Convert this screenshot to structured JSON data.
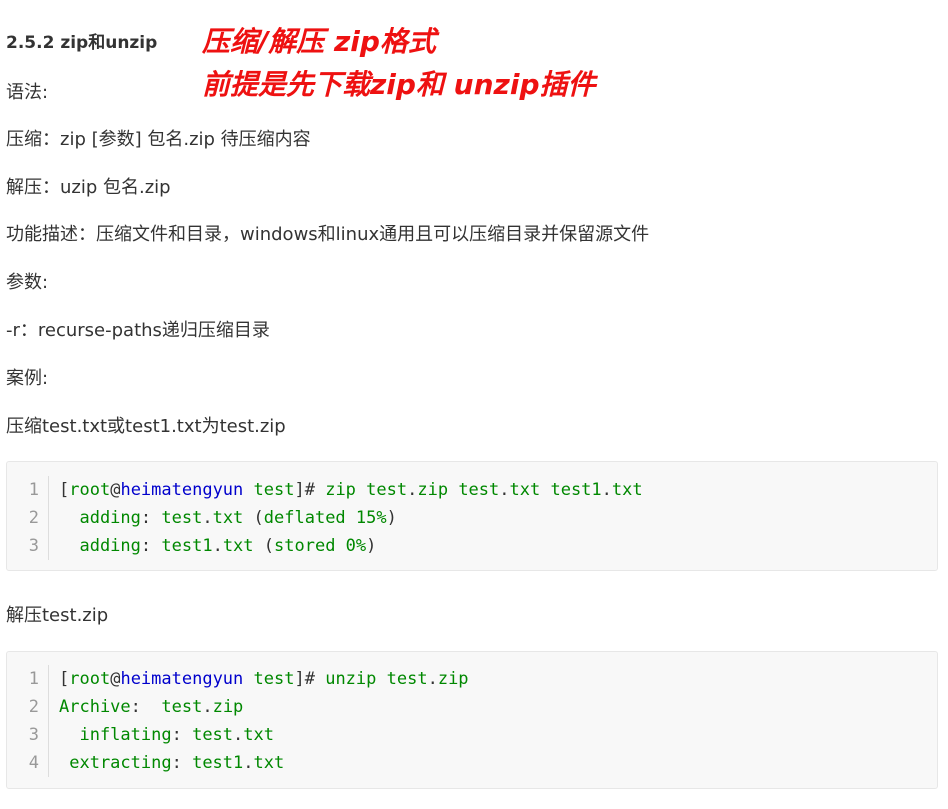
{
  "heading": "2.5.2 zip和unzip",
  "annotations": {
    "line1": "压缩/解压    zip格式",
    "line2": "前提是先下载zip和 unzip插件"
  },
  "paragraphs": {
    "syntax": "语法:",
    "compress": " 压缩：zip [参数] 包名.zip 待压缩内容",
    "decompress": " 解压：uzip 包名.zip",
    "description": "功能描述：压缩文件和目录，windows和linux通用且可以压缩目录并保留源文件",
    "params": "参数:",
    "param_r": " -r：recurse-paths递归压缩目录",
    "example": "案例:",
    "example1": "压缩test.txt或test1.txt为test.zip",
    "example2": "解压test.zip"
  },
  "code1": {
    "line_numbers": [
      "1",
      "2",
      "3"
    ],
    "lines": [
      [
        {
          "t": "[",
          "c": "d"
        },
        {
          "t": "root",
          "c": "g"
        },
        {
          "t": "@",
          "c": "d"
        },
        {
          "t": "heimatengyun",
          "c": "b"
        },
        {
          "t": " ",
          "c": "d"
        },
        {
          "t": "test",
          "c": "g"
        },
        {
          "t": "]# ",
          "c": "d"
        },
        {
          "t": "zip ",
          "c": "g"
        },
        {
          "t": "test",
          "c": "g"
        },
        {
          "t": ".",
          "c": "d"
        },
        {
          "t": "zip ",
          "c": "g"
        },
        {
          "t": "test",
          "c": "g"
        },
        {
          "t": ".",
          "c": "d"
        },
        {
          "t": "txt ",
          "c": "g"
        },
        {
          "t": "test1",
          "c": "g"
        },
        {
          "t": ".",
          "c": "d"
        },
        {
          "t": "txt",
          "c": "g"
        }
      ],
      [
        {
          "t": "  adding",
          "c": "g"
        },
        {
          "t": ": ",
          "c": "d"
        },
        {
          "t": "test",
          "c": "g"
        },
        {
          "t": ".",
          "c": "d"
        },
        {
          "t": "txt ",
          "c": "g"
        },
        {
          "t": "(",
          "c": "d"
        },
        {
          "t": "deflated 15%",
          "c": "g"
        },
        {
          "t": ")",
          "c": "d"
        }
      ],
      [
        {
          "t": "  adding",
          "c": "g"
        },
        {
          "t": ": ",
          "c": "d"
        },
        {
          "t": "test1",
          "c": "g"
        },
        {
          "t": ".",
          "c": "d"
        },
        {
          "t": "txt ",
          "c": "g"
        },
        {
          "t": "(",
          "c": "d"
        },
        {
          "t": "stored 0%",
          "c": "g"
        },
        {
          "t": ")",
          "c": "d"
        }
      ]
    ]
  },
  "code2": {
    "line_numbers": [
      "1",
      "2",
      "3",
      "4"
    ],
    "lines": [
      [
        {
          "t": "[",
          "c": "d"
        },
        {
          "t": "root",
          "c": "g"
        },
        {
          "t": "@",
          "c": "d"
        },
        {
          "t": "heimatengyun",
          "c": "b"
        },
        {
          "t": " ",
          "c": "d"
        },
        {
          "t": "test",
          "c": "g"
        },
        {
          "t": "]# ",
          "c": "d"
        },
        {
          "t": "unzip ",
          "c": "g"
        },
        {
          "t": "test",
          "c": "g"
        },
        {
          "t": ".",
          "c": "d"
        },
        {
          "t": "zip",
          "c": "g"
        }
      ],
      [
        {
          "t": "Archive",
          "c": "g"
        },
        {
          "t": ":  ",
          "c": "d"
        },
        {
          "t": "test",
          "c": "g"
        },
        {
          "t": ".",
          "c": "d"
        },
        {
          "t": "zip",
          "c": "g"
        }
      ],
      [
        {
          "t": "  inflating",
          "c": "g"
        },
        {
          "t": ": ",
          "c": "d"
        },
        {
          "t": "test",
          "c": "g"
        },
        {
          "t": ".",
          "c": "d"
        },
        {
          "t": "txt",
          "c": "g"
        }
      ],
      [
        {
          "t": " extracting",
          "c": "g"
        },
        {
          "t": ": ",
          "c": "d"
        },
        {
          "t": "test1",
          "c": "g"
        },
        {
          "t": ".",
          "c": "d"
        },
        {
          "t": "txt",
          "c": "g"
        }
      ]
    ]
  }
}
